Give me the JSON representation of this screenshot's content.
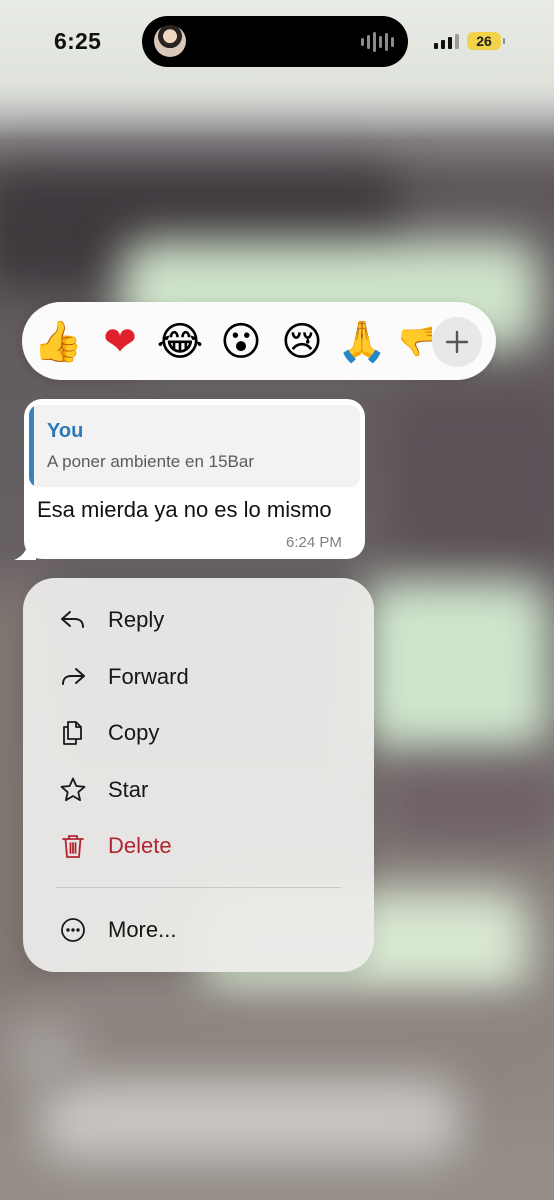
{
  "status_bar": {
    "time": "6:25",
    "battery": "26",
    "battery_color": "#f2d24a"
  },
  "reactions": {
    "emojis": [
      "👍",
      "❤",
      "😂",
      "😮",
      "😢",
      "🙏",
      "🫳"
    ],
    "add_icon": "plus-icon"
  },
  "message": {
    "reply_to": {
      "author": "You",
      "text": "A poner ambiente en 15Bar"
    },
    "text": "Esa mierda ya no es lo mismo",
    "time": "6:24 PM"
  },
  "menu": {
    "items": [
      {
        "label": "Reply",
        "icon": "reply-icon"
      },
      {
        "label": "Forward",
        "icon": "forward-icon"
      },
      {
        "label": "Copy",
        "icon": "copy-icon"
      },
      {
        "label": "Star",
        "icon": "star-icon"
      },
      {
        "label": "Delete",
        "icon": "trash-icon",
        "color": "#b32431"
      },
      {
        "label": "More...",
        "icon": "more-icon"
      }
    ]
  },
  "colors": {
    "accent_blue": "#2e79b7",
    "danger": "#b32431"
  }
}
